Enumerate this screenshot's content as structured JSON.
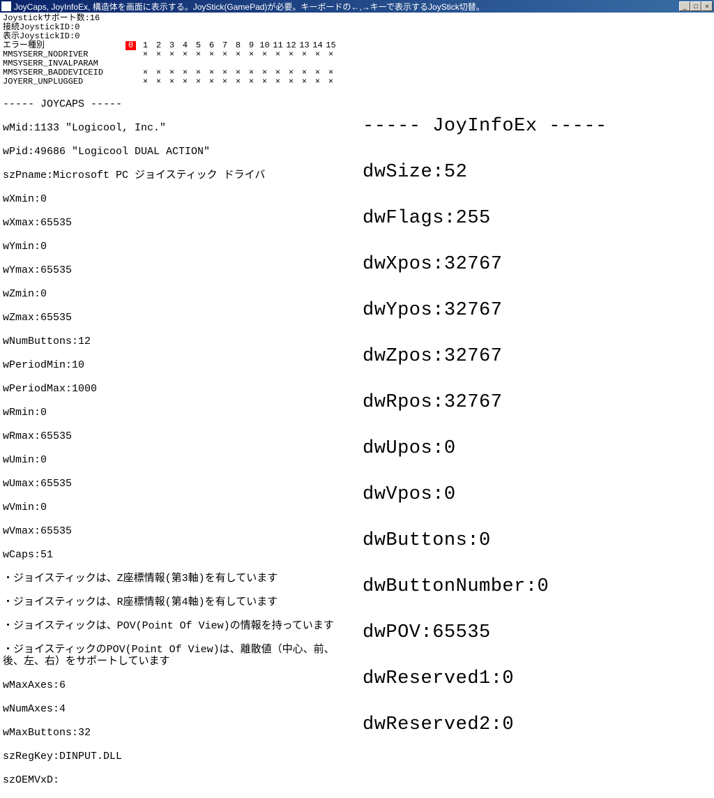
{
  "title": "JoyCaps, JoyInfoEx, 構造体を画面に表示する。JoyStick(GamePad)が必要。キーボードの←,→キーで表示するJoyStick切替。",
  "topinfo": {
    "support": "Joystickサポート数:16",
    "connected": "接続JoystickID:0",
    "display": "表示JoystickID:0"
  },
  "errorTable": {
    "header": "エラー種別",
    "cols": [
      "0",
      "1",
      "2",
      "3",
      "4",
      "5",
      "6",
      "7",
      "8",
      "9",
      "10",
      "11",
      "12",
      "13",
      "14",
      "15"
    ],
    "rows": [
      {
        "label": "MMSYSERR_NODRIVER",
        "marks": [
          null,
          "×",
          "×",
          "×",
          "×",
          "×",
          "×",
          "×",
          "×",
          "×",
          "×",
          "×",
          "×",
          "×",
          "×",
          "×"
        ]
      },
      {
        "label": "MMSYSERR_INVALPARAM",
        "marks": [
          null,
          null,
          null,
          null,
          null,
          null,
          null,
          null,
          null,
          null,
          null,
          null,
          null,
          null,
          null,
          null
        ]
      },
      {
        "label": "MMSYSERR_BADDEVICEID",
        "marks": [
          null,
          "×",
          "×",
          "×",
          "×",
          "×",
          "×",
          "×",
          "×",
          "×",
          "×",
          "×",
          "×",
          "×",
          "×",
          "×"
        ]
      },
      {
        "label": "JOYERR_UNPLUGGED",
        "marks": [
          null,
          "×",
          "×",
          "×",
          "×",
          "×",
          "×",
          "×",
          "×",
          "×",
          "×",
          "×",
          "×",
          "×",
          "×",
          "×"
        ]
      }
    ],
    "selected": 0
  },
  "joycaps": {
    "heading": "----- JOYCAPS -----",
    "wMid": "wMid:1133 \"Logicool, Inc.\"",
    "wPid": "wPid:49686 \"Logicool DUAL ACTION\"",
    "szPname": "szPname:Microsoft PC ジョイスティック ドライバ",
    "wXmin": "wXmin:0",
    "wXmax": "wXmax:65535",
    "wYmin": "wYmin:0",
    "wYmax": "wYmax:65535",
    "wZmin": "wZmin:0",
    "wZmax": "wZmax:65535",
    "wNumButtons": "wNumButtons:12",
    "wPeriodMin": "wPeriodMin:10",
    "wPeriodMax": "wPeriodMax:1000",
    "wRmin": "wRmin:0",
    "wRmax": "wRmax:65535",
    "wUmin": "wUmin:0",
    "wUmax": "wUmax:65535",
    "wVmin": "wVmin:0",
    "wVmax": "wVmax:65535",
    "wCaps": "wCaps:51",
    "caps1": "・ジョイスティックは、Z座標情報(第3軸)を有しています",
    "caps2": "・ジョイスティックは、R座標情報(第4軸)を有しています",
    "caps3": "・ジョイスティックは、POV(Point Of View)の情報を持っています",
    "caps4": "・ジョイスティックのPOV(Point Of View)は、離散値（中心、前、後、左、右）をサポートしています",
    "wMaxAxes": "wMaxAxes:6",
    "wNumAxes": "wNumAxes:4",
    "wMaxButtons": "wMaxButtons:32",
    "szRegKey": "szRegKey:DINPUT.DLL",
    "szOEMVxD": "szOEMVxD:"
  },
  "joyinfoex": {
    "heading": "----- JoyInfoEx -----",
    "dwSize": "dwSize:52",
    "dwFlags": "dwFlags:255",
    "dwXpos": "dwXpos:32767",
    "dwYpos": "dwYpos:32767",
    "dwZpos": "dwZpos:32767",
    "dwRpos": "dwRpos:32767",
    "dwUpos": "dwUpos:0",
    "dwVpos": "dwVpos:0",
    "dwButtons": "dwButtons:0",
    "dwButtonNumber": "dwButtonNumber:0",
    "dwPOV": "dwPOV:65535",
    "dwReserved1": "dwReserved1:0",
    "dwReserved2": "dwReserved2:0"
  },
  "winbtns": {
    "min": "_",
    "max": "□",
    "close": "×"
  }
}
